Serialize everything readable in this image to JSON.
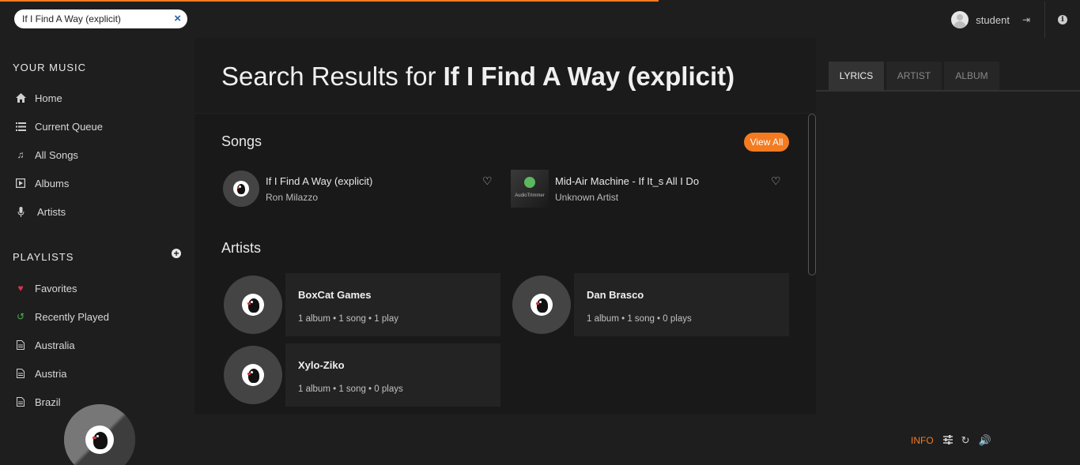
{
  "progress": {
    "fraction": 0.61
  },
  "search": {
    "value": "If I Find A Way (explicit)",
    "clear_label": "×"
  },
  "user": {
    "name": "student"
  },
  "sidebar": {
    "your_music_heading": "YOUR MUSIC",
    "music_items": [
      {
        "label": "Home",
        "icon": "home-icon"
      },
      {
        "label": "Current Queue",
        "icon": "queue-icon"
      },
      {
        "label": "All Songs",
        "icon": "music-note-icon"
      },
      {
        "label": "Albums",
        "icon": "album-icon"
      },
      {
        "label": "Artists",
        "icon": "microphone-icon"
      }
    ],
    "playlists_heading": "PLAYLISTS",
    "playlist_items": [
      {
        "label": "Favorites",
        "icon": "heart-icon"
      },
      {
        "label": "Recently Played",
        "icon": "history-icon"
      },
      {
        "label": "Australia",
        "icon": "file-icon"
      },
      {
        "label": "Austria",
        "icon": "file-icon"
      },
      {
        "label": "Brazil",
        "icon": "file-icon"
      }
    ]
  },
  "main": {
    "title_prefix": "Search Results for",
    "title_query": "If I Find A Way (explicit)",
    "songs_heading": "Songs",
    "view_all_label": "View All",
    "songs": [
      {
        "title": "If I Find A Way (explicit)",
        "artist": "Ron Milazzo"
      },
      {
        "title": "Mid-Air Machine - If It_s All I Do",
        "artist": "Unknown Artist",
        "thumb_text": "AudioTrimmer"
      }
    ],
    "artists_heading": "Artists",
    "artists": [
      {
        "name": "BoxCat Games",
        "meta": "1 album • 1 song • 1 play"
      },
      {
        "name": "Dan Brasco",
        "meta": "1 album • 1 song • 0 plays"
      },
      {
        "name": "Xylo-Ziko",
        "meta": "1 album • 1 song • 0 plays"
      }
    ]
  },
  "rightpanel": {
    "tabs": [
      "LYRICS",
      "ARTIST",
      "ALBUM"
    ],
    "active_tab": "LYRICS"
  },
  "footer": {
    "info_label": "INFO"
  },
  "colors": {
    "accent": "#f47b20",
    "favorite": "#e0304e",
    "history": "#4caf50"
  }
}
